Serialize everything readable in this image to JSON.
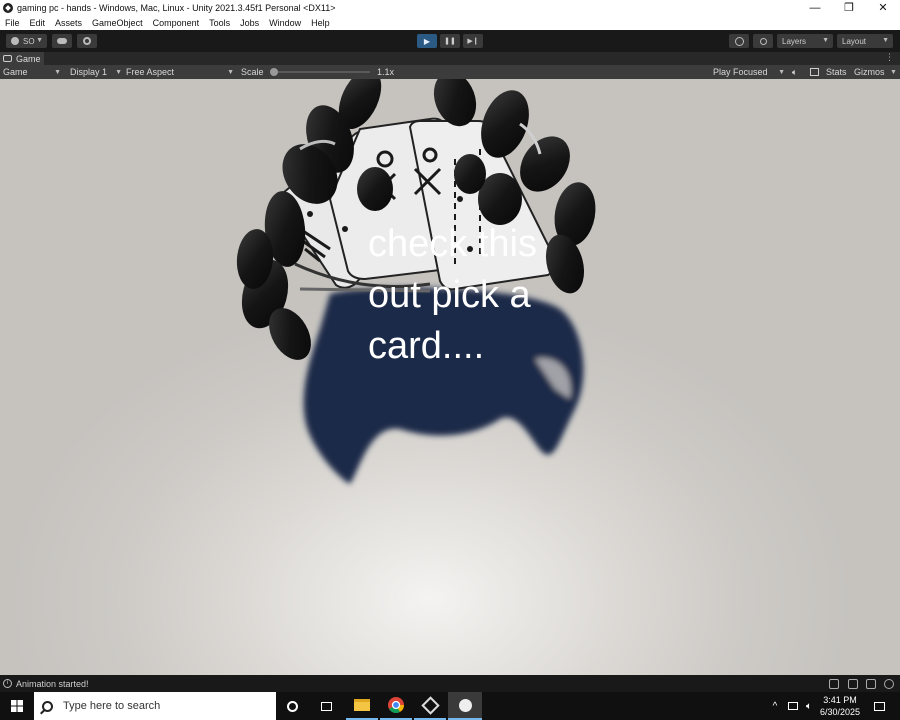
{
  "window": {
    "title": "gaming pc - hands - Windows, Mac, Linux - Unity 2021.3.45f1 Personal <DX11>",
    "controls": {
      "minimize": "—",
      "maximize": "❐",
      "close": "✕"
    }
  },
  "menu": [
    "File",
    "Edit",
    "Assets",
    "GameObject",
    "Component",
    "Tools",
    "Jobs",
    "Window",
    "Help"
  ],
  "toolbar": {
    "account_label": "SO",
    "play_icon": "▶",
    "pause_icon": "❚❚",
    "step_icon": "▶❙",
    "layers_label": "Layers",
    "layout_label": "Layout"
  },
  "tab": {
    "label": "Game",
    "more": "⋮"
  },
  "game_bar": {
    "mode": "Game",
    "display": "Display 1",
    "aspect": "Free Aspect",
    "scale_label": "Scale",
    "scale_value": "1.1x",
    "play_focused": "Play Focused",
    "stats": "Stats",
    "gizmos": "Gizmos"
  },
  "scene": {
    "dialogue": "check this out pick a card....",
    "colors": {
      "hand": "#141414",
      "card": "#e9e9e9",
      "shadow": "#1e2a48",
      "floor": "#d9d6d2"
    }
  },
  "status": {
    "message": "Animation started!"
  },
  "taskbar": {
    "search_placeholder": "Type here to search",
    "time": "3:41 PM",
    "date": "6/30/2025",
    "apps": [
      "start-icon",
      "cortana-icon",
      "task-view-icon",
      "file-explorer-icon",
      "chrome-icon",
      "unity-hub-icon",
      "unity-editor-icon"
    ]
  }
}
